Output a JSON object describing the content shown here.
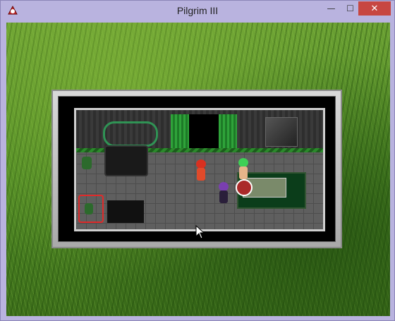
{
  "window": {
    "title": "Pilgrim III",
    "controls": {
      "minimize": "—",
      "maximize": "☐",
      "close": "✕"
    },
    "icons": {
      "app": "app-icon",
      "close": "close-icon"
    },
    "colors": {
      "chrome": "#b9b3df",
      "close_button": "#c74641"
    }
  },
  "game": {
    "scene": "interior room",
    "sprites": [
      {
        "name": "npc-red",
        "hair_color": "#d83020"
      },
      {
        "name": "npc-green",
        "hair_color": "#3fcf55"
      },
      {
        "name": "player-purple",
        "hair_color": "#7a3fb0"
      }
    ],
    "selection_color": "#e02a2a",
    "background": "grass"
  }
}
